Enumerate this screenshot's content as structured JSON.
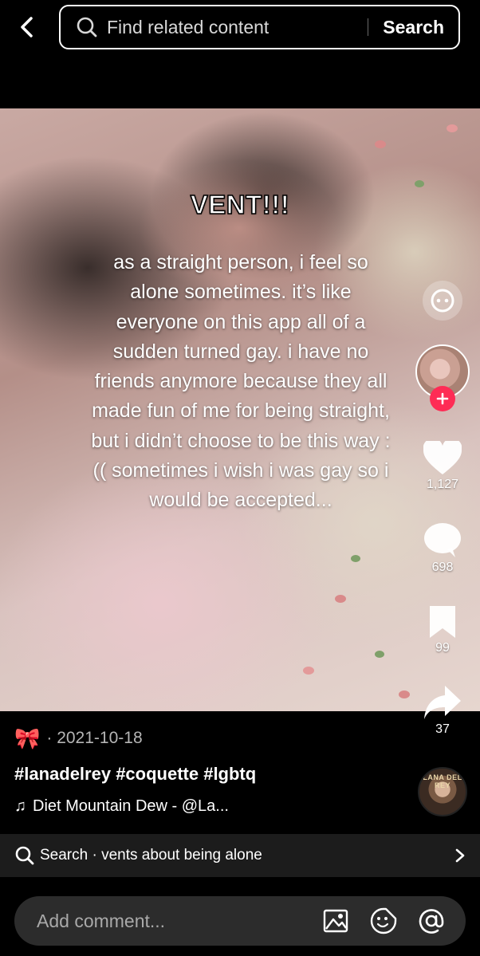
{
  "header": {
    "search_placeholder": "Find related content",
    "search_button": "Search"
  },
  "video": {
    "title": "VENT!!!",
    "body": "as  a straight person, i feel so alone sometimes. it’s like everyone on this app all of a sudden turned gay. i have no friends anymore because they all made fun of me for being straight, but i didn’t choose to be this way :(( sometimes i wish i was gay so i would be accepted..."
  },
  "actions": {
    "likes": "1,127",
    "comments": "698",
    "saves": "99",
    "shares": "37"
  },
  "post": {
    "author_emoji": "🎀",
    "date": "· 2021-10-18",
    "hashtags": "#lanadelrey #coquette #lgbtq",
    "music_note": "♫",
    "music": "Diet Mountain Dew - @La...",
    "album_art_text": "LANA DEL REY"
  },
  "search_suggestion": {
    "text": "Search · vents about being alone"
  },
  "comment_bar": {
    "placeholder": "Add comment..."
  },
  "colors": {
    "background": "#000000",
    "follow_badge": "#fe2c55",
    "suggest_bar": "#1c1c1c",
    "comment_bar": "#2c2c2c"
  }
}
